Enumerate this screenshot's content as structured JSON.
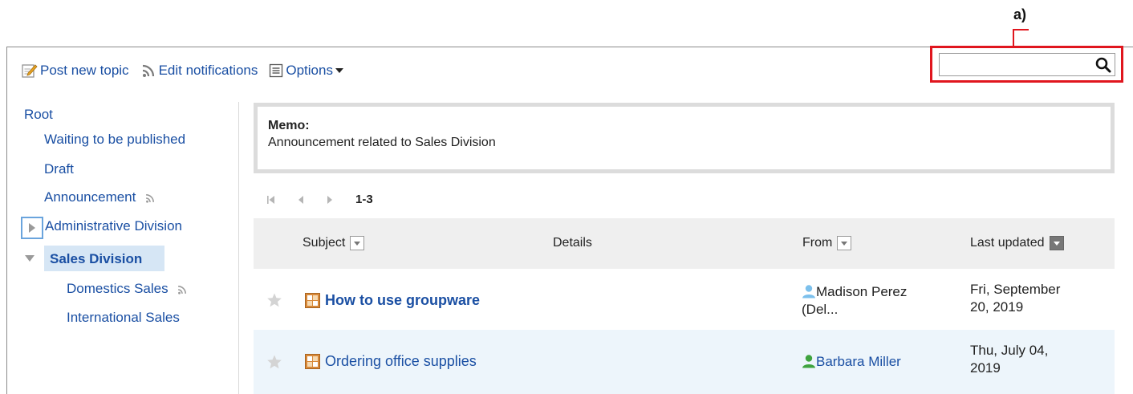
{
  "callout": {
    "label": "a)"
  },
  "search": {
    "placeholder": "",
    "value": ""
  },
  "toolbar": {
    "post_new_topic": "Post new topic",
    "edit_notifications": "Edit notifications",
    "options": "Options"
  },
  "sidebar": {
    "root": "Root",
    "items": [
      {
        "label": "Waiting to be published"
      },
      {
        "label": "Draft"
      },
      {
        "label": "Announcement"
      },
      {
        "label": "Administrative Division"
      },
      {
        "label": "Sales Division"
      },
      {
        "label": "Domestics Sales"
      },
      {
        "label": "International Sales"
      }
    ]
  },
  "memo": {
    "title": "Memo:",
    "text": "Announcement related to Sales Division"
  },
  "pager": {
    "range": "1-3"
  },
  "table": {
    "columns": {
      "subject": "Subject",
      "details": "Details",
      "from": "From",
      "last_updated": "Last updated"
    },
    "rows": [
      {
        "subject": "How to use groupware",
        "subject_bold": true,
        "from_line1": "Madison Perez",
        "from_line2": "(Del...",
        "updated_line1": "Fri, September",
        "updated_line2": "20, 2019"
      },
      {
        "subject": "Ordering office supplies",
        "subject_bold": false,
        "from_line1": "Barbara Miller",
        "updated_line1": "Thu, July 04,",
        "updated_line2": "2019"
      }
    ]
  },
  "colors": {
    "link": "#1a4fa3",
    "callout": "#e0161e",
    "selected_bg": "#d6e6f5",
    "row_alt_bg": "#edf5fb",
    "header_bg": "#efefef"
  }
}
